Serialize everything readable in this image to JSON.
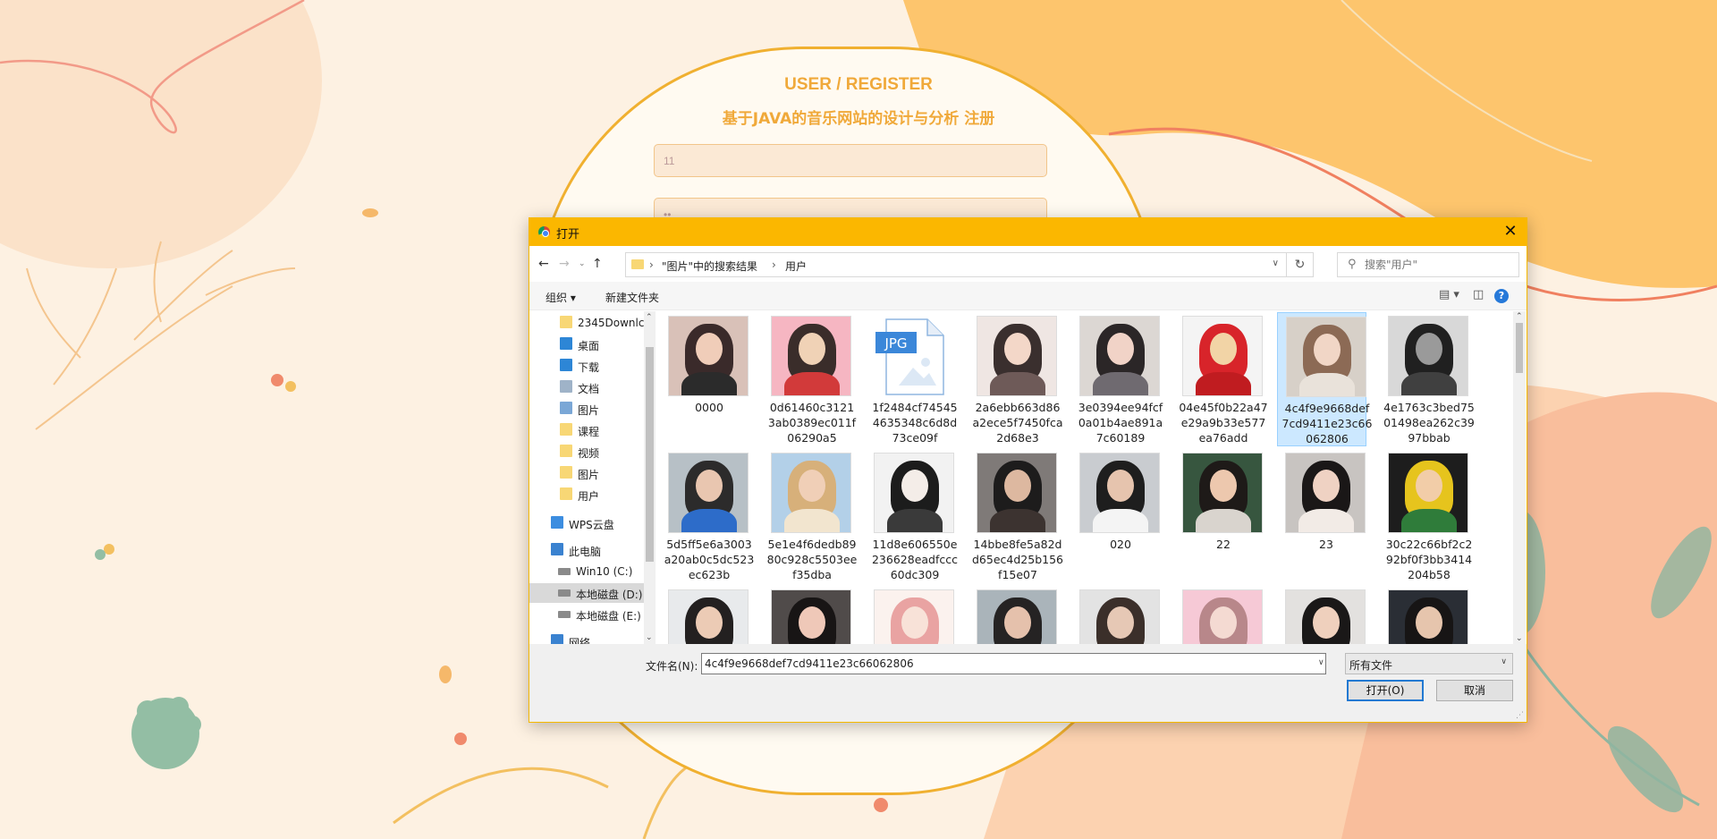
{
  "page": {
    "title1": "USER / REGISTER",
    "title2": "基于JAVA的音乐网站的设计与分析 注册",
    "inputs": [
      "11",
      "••"
    ]
  },
  "dialog": {
    "title": "打开",
    "close": "✕",
    "breadcrumb": [
      "\"图片\"中的搜索结果",
      "用户"
    ],
    "search_placeholder": "搜索\"用户\"",
    "toolbar": {
      "organize": "组织 ▾",
      "new_folder": "新建文件夹"
    },
    "nav_items": [
      {
        "label": "2345Downlc",
        "icon": "folder",
        "pinned": true
      },
      {
        "label": "桌面",
        "icon": "desktop",
        "pinned": true
      },
      {
        "label": "下载",
        "icon": "download",
        "pinned": true
      },
      {
        "label": "文档",
        "icon": "document",
        "pinned": true
      },
      {
        "label": "图片",
        "icon": "pictures",
        "pinned": true
      },
      {
        "label": "课程",
        "icon": "folder",
        "pinned": false
      },
      {
        "label": "视频",
        "icon": "folder",
        "pinned": false
      },
      {
        "label": "图片",
        "icon": "folder",
        "pinned": false
      },
      {
        "label": "用户",
        "icon": "folder",
        "pinned": false
      },
      {
        "label": "WPS云盘",
        "icon": "cloud",
        "pinned": false
      },
      {
        "label": "此电脑",
        "icon": "computer",
        "pinned": false
      },
      {
        "label": "Win10 (C:)",
        "icon": "drive",
        "pinned": false
      },
      {
        "label": "本地磁盘 (D:)",
        "icon": "drive",
        "pinned": false,
        "selected": true
      },
      {
        "label": "本地磁盘 (E:)",
        "icon": "drive",
        "pinned": false
      },
      {
        "label": "网络",
        "icon": "network",
        "pinned": false
      }
    ],
    "files": [
      {
        "name": "0000",
        "thumb": "girl-dark-hair"
      },
      {
        "name": "0d61460c31213ab0389ec011f06290a5",
        "thumb": "cartoon-monkey"
      },
      {
        "name": "1f2484cf745454635348c6d8d73ce09f",
        "thumb": "jpg-file"
      },
      {
        "name": "2a6ebb663d86a2ece5f7450fca2d68e3",
        "thumb": "girl-bob"
      },
      {
        "name": "3e0394ee94fcf0a01b4ae891a7c60189",
        "thumb": "girl-checked"
      },
      {
        "name": "04e45f0b22a47e29a9b33e577ea76add",
        "thumb": "angry-bird"
      },
      {
        "name": "4c4f9e9668def7cd9411e23c66062806",
        "thumb": "girl-light",
        "selected": true
      },
      {
        "name": "4e1763c3bed7501498ea262c3997bbab",
        "thumb": "man-bw"
      },
      {
        "name": "5d5ff5e6a3003a20ab0c5dc523ec623b",
        "thumb": "girl-road"
      },
      {
        "name": "5e1e4f6dedb8980c928c5503eef35dba",
        "thumb": "girl-hat"
      },
      {
        "name": "11d8e606550e236628eadfccc60dc309",
        "thumb": "anime-sketch"
      },
      {
        "name": "14bbe8fe5a82dd65ec4d25b156f15e07",
        "thumb": "boy-dog"
      },
      {
        "name": "020",
        "thumb": "boy-white"
      },
      {
        "name": "22",
        "thumb": "boy-glasses"
      },
      {
        "name": "23",
        "thumb": "girl-sitting"
      },
      {
        "name": "30c22c66bf2c292bf0f3bb3414204b58",
        "thumb": "cartoon-glasses"
      },
      {
        "name": "",
        "thumb": "boy-portrait"
      },
      {
        "name": "",
        "thumb": "girl-dark"
      },
      {
        "name": "",
        "thumb": "anime-pink"
      },
      {
        "name": "",
        "thumb": "girl-road2"
      },
      {
        "name": "",
        "thumb": "boy-mask"
      },
      {
        "name": "",
        "thumb": "girl-pink"
      },
      {
        "name": "",
        "thumb": "girl-standing"
      },
      {
        "name": "",
        "thumb": "boy-dark"
      }
    ],
    "filename_label": "文件名(N):",
    "filename_value": "4c4f9e9668def7cd9411e23c66062806",
    "filetype": "所有文件",
    "open_button": "打开(O)",
    "cancel_button": "取消"
  }
}
